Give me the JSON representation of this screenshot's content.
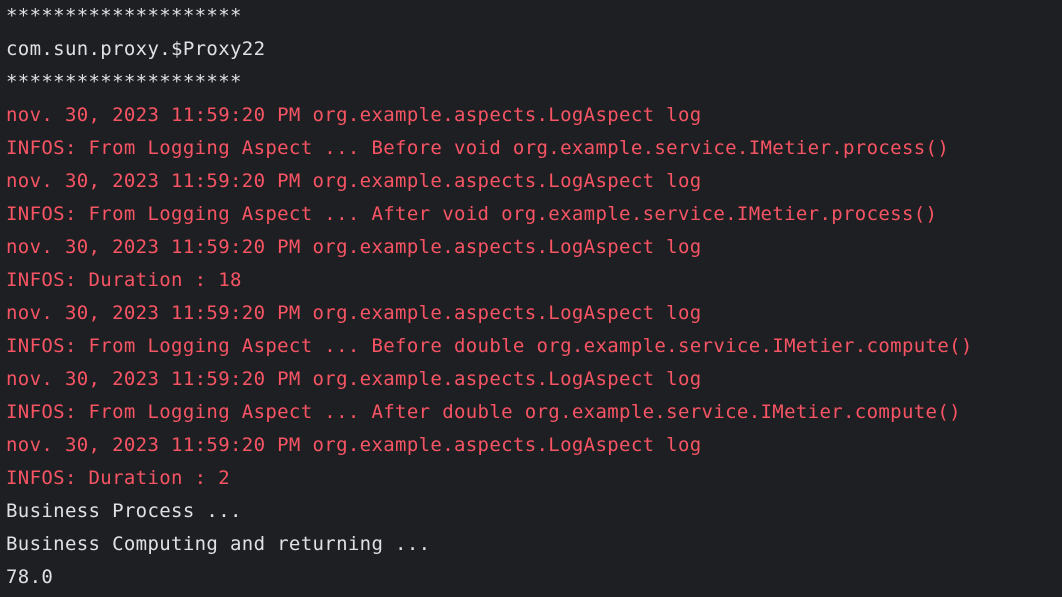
{
  "console": {
    "colors": {
      "background": "#1e1f22",
      "stdout": "#dfe1e5",
      "stderr": "#f75464"
    },
    "lines": [
      {
        "text": "********************",
        "stream": "stdout"
      },
      {
        "text": "com.sun.proxy.$Proxy22",
        "stream": "stdout"
      },
      {
        "text": "********************",
        "stream": "stdout"
      },
      {
        "text": "nov. 30, 2023 11:59:20 PM org.example.aspects.LogAspect log",
        "stream": "stderr"
      },
      {
        "text": "INFOS: From Logging Aspect ... Before void org.example.service.IMetier.process()",
        "stream": "stderr"
      },
      {
        "text": "nov. 30, 2023 11:59:20 PM org.example.aspects.LogAspect log",
        "stream": "stderr"
      },
      {
        "text": "INFOS: From Logging Aspect ... After void org.example.service.IMetier.process()",
        "stream": "stderr"
      },
      {
        "text": "nov. 30, 2023 11:59:20 PM org.example.aspects.LogAspect log",
        "stream": "stderr"
      },
      {
        "text": "INFOS: Duration : 18",
        "stream": "stderr"
      },
      {
        "text": "nov. 30, 2023 11:59:20 PM org.example.aspects.LogAspect log",
        "stream": "stderr"
      },
      {
        "text": "INFOS: From Logging Aspect ... Before double org.example.service.IMetier.compute()",
        "stream": "stderr"
      },
      {
        "text": "nov. 30, 2023 11:59:20 PM org.example.aspects.LogAspect log",
        "stream": "stderr"
      },
      {
        "text": "INFOS: From Logging Aspect ... After double org.example.service.IMetier.compute()",
        "stream": "stderr"
      },
      {
        "text": "nov. 30, 2023 11:59:20 PM org.example.aspects.LogAspect log",
        "stream": "stderr"
      },
      {
        "text": "INFOS: Duration : 2",
        "stream": "stderr"
      },
      {
        "text": "Business Process ...",
        "stream": "stdout"
      },
      {
        "text": "Business Computing and returning ...",
        "stream": "stdout"
      },
      {
        "text": "78.0",
        "stream": "stdout"
      }
    ]
  }
}
